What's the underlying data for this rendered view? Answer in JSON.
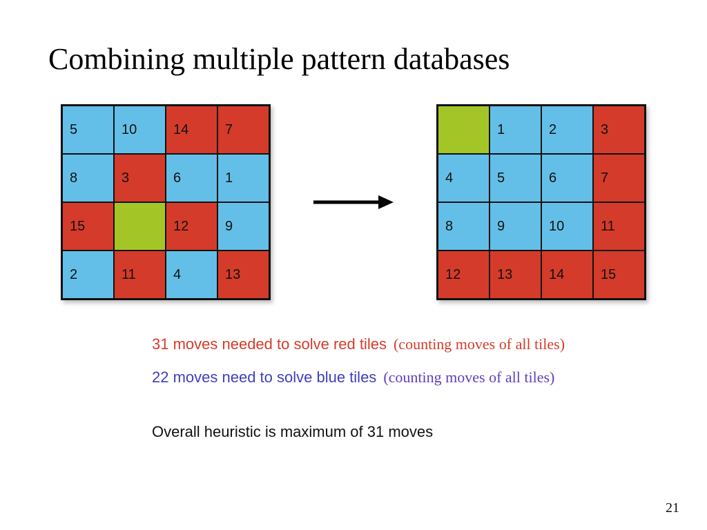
{
  "title": "Combining multiple pattern databases",
  "page_number": "21",
  "colors": {
    "blue": "#64bfe8",
    "red": "#d53b2a",
    "green": "#a3c626"
  },
  "left_grid": [
    {
      "v": "5",
      "c": "blue"
    },
    {
      "v": "10",
      "c": "blue"
    },
    {
      "v": "14",
      "c": "red"
    },
    {
      "v": "7",
      "c": "red"
    },
    {
      "v": "8",
      "c": "blue"
    },
    {
      "v": "3",
      "c": "red"
    },
    {
      "v": "6",
      "c": "blue"
    },
    {
      "v": "1",
      "c": "blue"
    },
    {
      "v": "15",
      "c": "red"
    },
    {
      "v": "",
      "c": "green"
    },
    {
      "v": "12",
      "c": "red"
    },
    {
      "v": "9",
      "c": "blue"
    },
    {
      "v": "2",
      "c": "blue"
    },
    {
      "v": "11",
      "c": "red"
    },
    {
      "v": "4",
      "c": "blue"
    },
    {
      "v": "13",
      "c": "red"
    }
  ],
  "right_grid": [
    {
      "v": "",
      "c": "green"
    },
    {
      "v": "1",
      "c": "blue"
    },
    {
      "v": "2",
      "c": "blue"
    },
    {
      "v": "3",
      "c": "red"
    },
    {
      "v": "4",
      "c": "blue"
    },
    {
      "v": "5",
      "c": "blue"
    },
    {
      "v": "6",
      "c": "blue"
    },
    {
      "v": "7",
      "c": "red"
    },
    {
      "v": "8",
      "c": "blue"
    },
    {
      "v": "9",
      "c": "blue"
    },
    {
      "v": "10",
      "c": "blue"
    },
    {
      "v": "11",
      "c": "red"
    },
    {
      "v": "12",
      "c": "red"
    },
    {
      "v": "13",
      "c": "red"
    },
    {
      "v": "14",
      "c": "red"
    },
    {
      "v": "15",
      "c": "red"
    }
  ],
  "notes": {
    "red_main": "31 moves needed to solve red tiles",
    "red_paren": "(counting moves of all tiles)",
    "blue_main": "22 moves need to solve blue tiles",
    "blue_paren": "(counting moves of all tiles)",
    "overall": "Overall heuristic is maximum of 31 moves"
  }
}
